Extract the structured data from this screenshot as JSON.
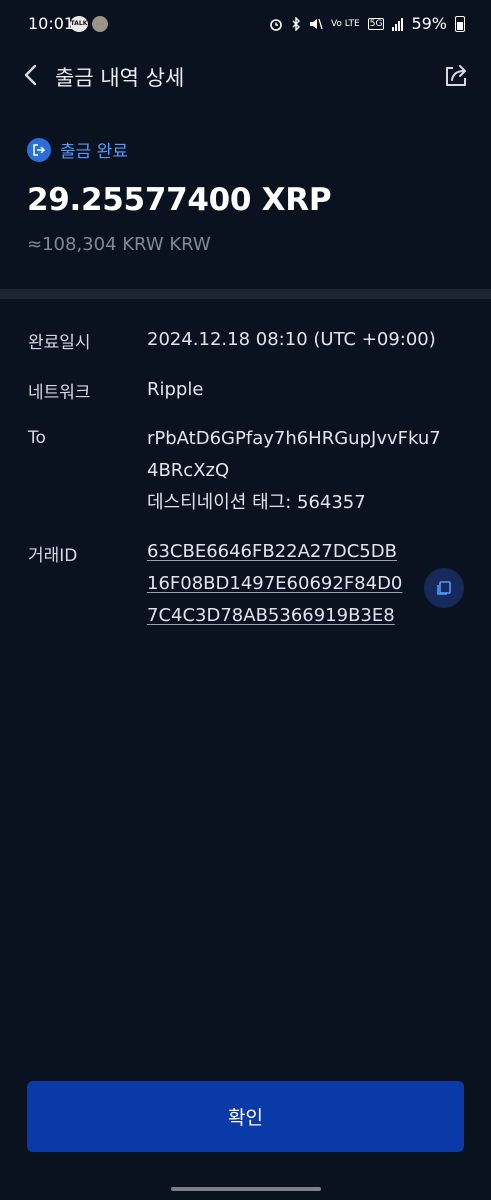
{
  "status_bar": {
    "time": "10:01",
    "talk_badge": "TALK",
    "network": "Vo LTE",
    "network_type": "5G",
    "battery": "59%"
  },
  "header": {
    "title": "출금 내역 상세",
    "back_icon": "chevron-left-icon",
    "share_icon": "share-icon"
  },
  "summary": {
    "status": "출금 완료",
    "amount": "29.25577400 XRP",
    "krw_equivalent": "≈108,304 KRW KRW"
  },
  "details": {
    "completed_at": {
      "label": "완료일시",
      "value": "2024.12.18 08:10 (UTC +09:00)"
    },
    "network": {
      "label": "네트워크",
      "value": "Ripple"
    },
    "to": {
      "label": "To",
      "address_line1": "rPbAtD6GPfay7h6HRGupJvvFku7",
      "address_line2": "4BRcXzQ",
      "destination_tag": "데스티네이션 태그: 564357"
    },
    "tx_id": {
      "label": "거래ID",
      "line1": "63CBE6646FB22A27DC5DB",
      "line2": "16F08BD1497E60692F84D0",
      "line3": "7C4C3D78AB5366919B3E8"
    }
  },
  "confirm_button": "확인",
  "colors": {
    "background": "#0a1220",
    "accent_blue": "#4f9bff",
    "button_blue": "#0a3aa8",
    "divider": "#1b2433"
  }
}
